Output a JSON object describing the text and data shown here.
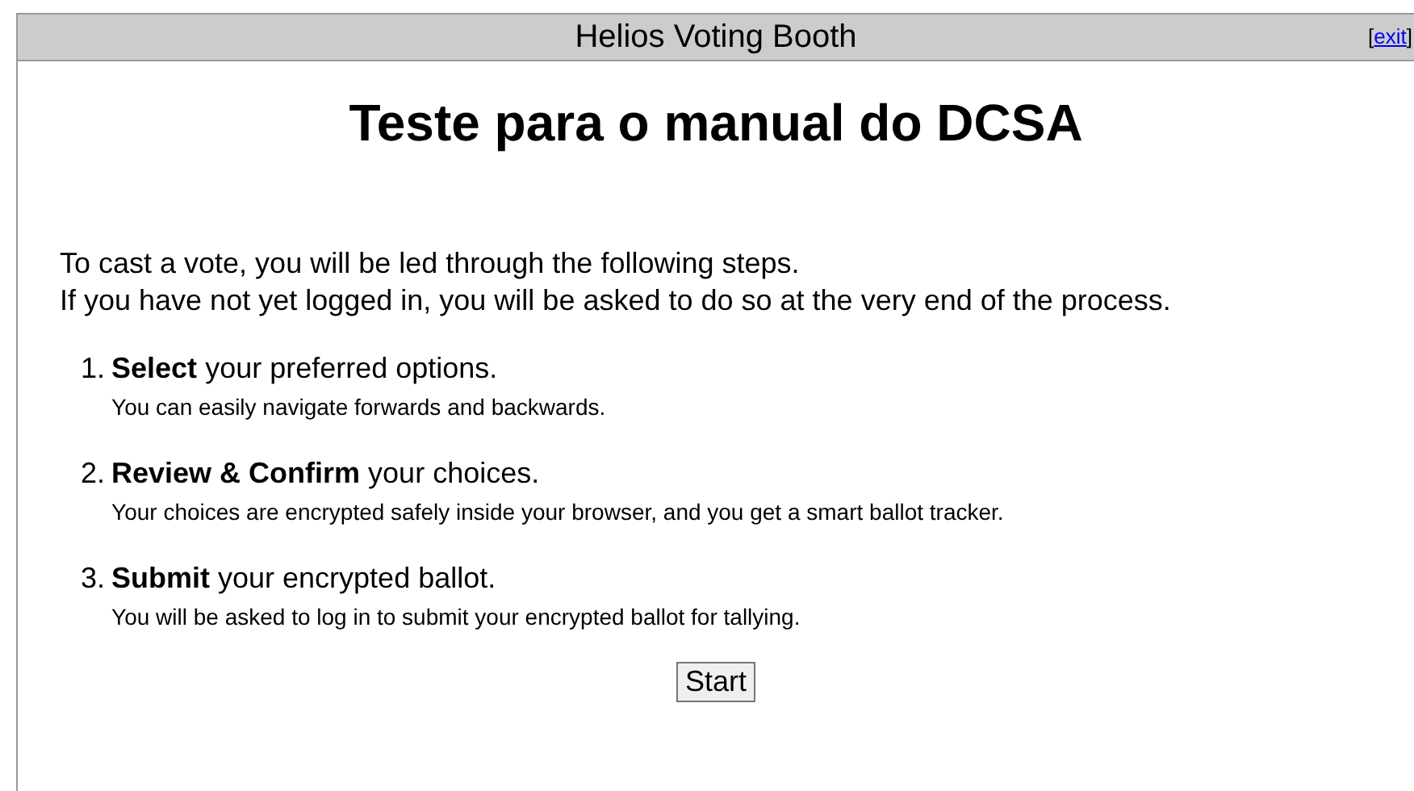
{
  "header": {
    "title": "Helios Voting Booth",
    "exit": {
      "open": "[",
      "label": "exit",
      "close": "]"
    }
  },
  "election_title": "Teste para o manual do DCSA",
  "intro": [
    "To cast a vote, you will be led through the following steps.",
    "If you have not yet logged in, you will be asked to do so at the very end of the process."
  ],
  "steps": [
    {
      "number": "1.",
      "text": "**Select** your preferred options.",
      "detail": "You can easily navigate forwards and backwards."
    },
    {
      "number": "2.",
      "text": "**Review & Confirm** your choices.",
      "detail": "Your choices are encrypted safely inside your browser, and you get a smart ballot tracker."
    },
    {
      "number": "3.",
      "text": "**Submit** your encrypted ballot.",
      "detail": "You will be asked to log in to submit your encrypted ballot for tallying."
    }
  ],
  "start_button": "Start"
}
